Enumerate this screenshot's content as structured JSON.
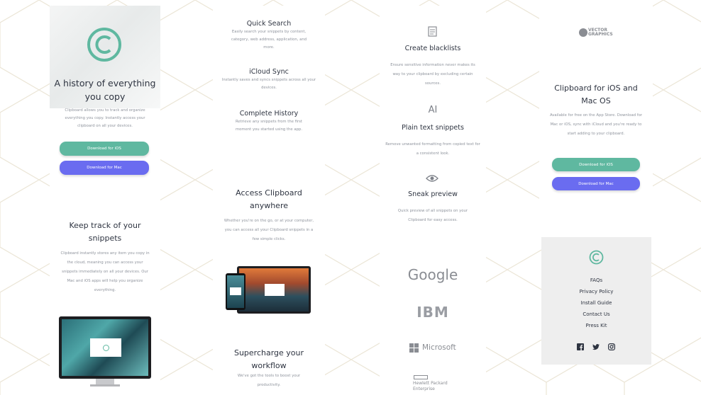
{
  "hero": {
    "title": "A history of everything you copy",
    "description": "Clipboard allows you to track and organize everything you copy. Instantly access your clipboard on all your devices.",
    "ios_button": "Download for iOS",
    "mac_button": "Download for Mac"
  },
  "track": {
    "title": "Keep track of your snippets",
    "description": "Clipboard instantly stores any item you copy in the cloud, meaning you can access your snippets immediately on all your devices. Our Mac and iOS apps will help you organize everything."
  },
  "features": [
    {
      "title": "Quick Search",
      "description": "Easily search your snippets by content, category, web address, application, and more."
    },
    {
      "title": "iCloud Sync",
      "description": "Instantly saves and syncs snippets across all your devices."
    },
    {
      "title": "Complete History",
      "description": "Retrieve any snippets from the first moment you started using the app."
    }
  ],
  "access": {
    "title": "Access Clipboard anywhere",
    "description": "Whether you're on the go, or at your computer, you can access all your Clipboard snippets in a few simple clicks."
  },
  "supercharge": {
    "title": "Supercharge your workflow",
    "description": "We've got the tools to boost your productivity."
  },
  "tools": [
    {
      "title": "Create blacklists",
      "icon": "document-icon",
      "description": "Ensure sensitive information never makes its way to your clipboard by excluding certain sources."
    },
    {
      "title": "Plain text snippets",
      "icon": "text-cursor-icon",
      "description": "Remove unwanted formatting from copied text for a consistent look."
    },
    {
      "title": "Sneak preview",
      "icon": "eye-icon",
      "description": "Quick preview of all snippets on your Clipboard for easy access."
    }
  ],
  "partners": {
    "google": "Google",
    "ibm": "IBM",
    "microsoft": "Microsoft",
    "hp_line1": "Hewlett Packard",
    "hp_line2": "Enterprise",
    "vector_line1": "VECTOR",
    "vector_line2": "GRAPHICS"
  },
  "cta": {
    "title": "Clipboard for iOS and Mac OS",
    "description": "Available for free on the App Store. Download for Mac or iOS, sync with iCloud and you're ready to start adding to your clipboard.",
    "ios_button": "Download for iOS",
    "mac_button": "Download for Mac"
  },
  "footer": {
    "links": [
      "FAQs",
      "Privacy Policy",
      "Install Guide",
      "Contact Us",
      "Press Kit"
    ],
    "social": [
      "facebook-icon",
      "twitter-icon",
      "instagram-icon"
    ]
  },
  "colors": {
    "accent_green": "#5fb8a0",
    "accent_blue": "#6a6cf0",
    "heading": "#2e3441",
    "body_text": "#8e939c",
    "pattern": "#e8e2d2"
  }
}
